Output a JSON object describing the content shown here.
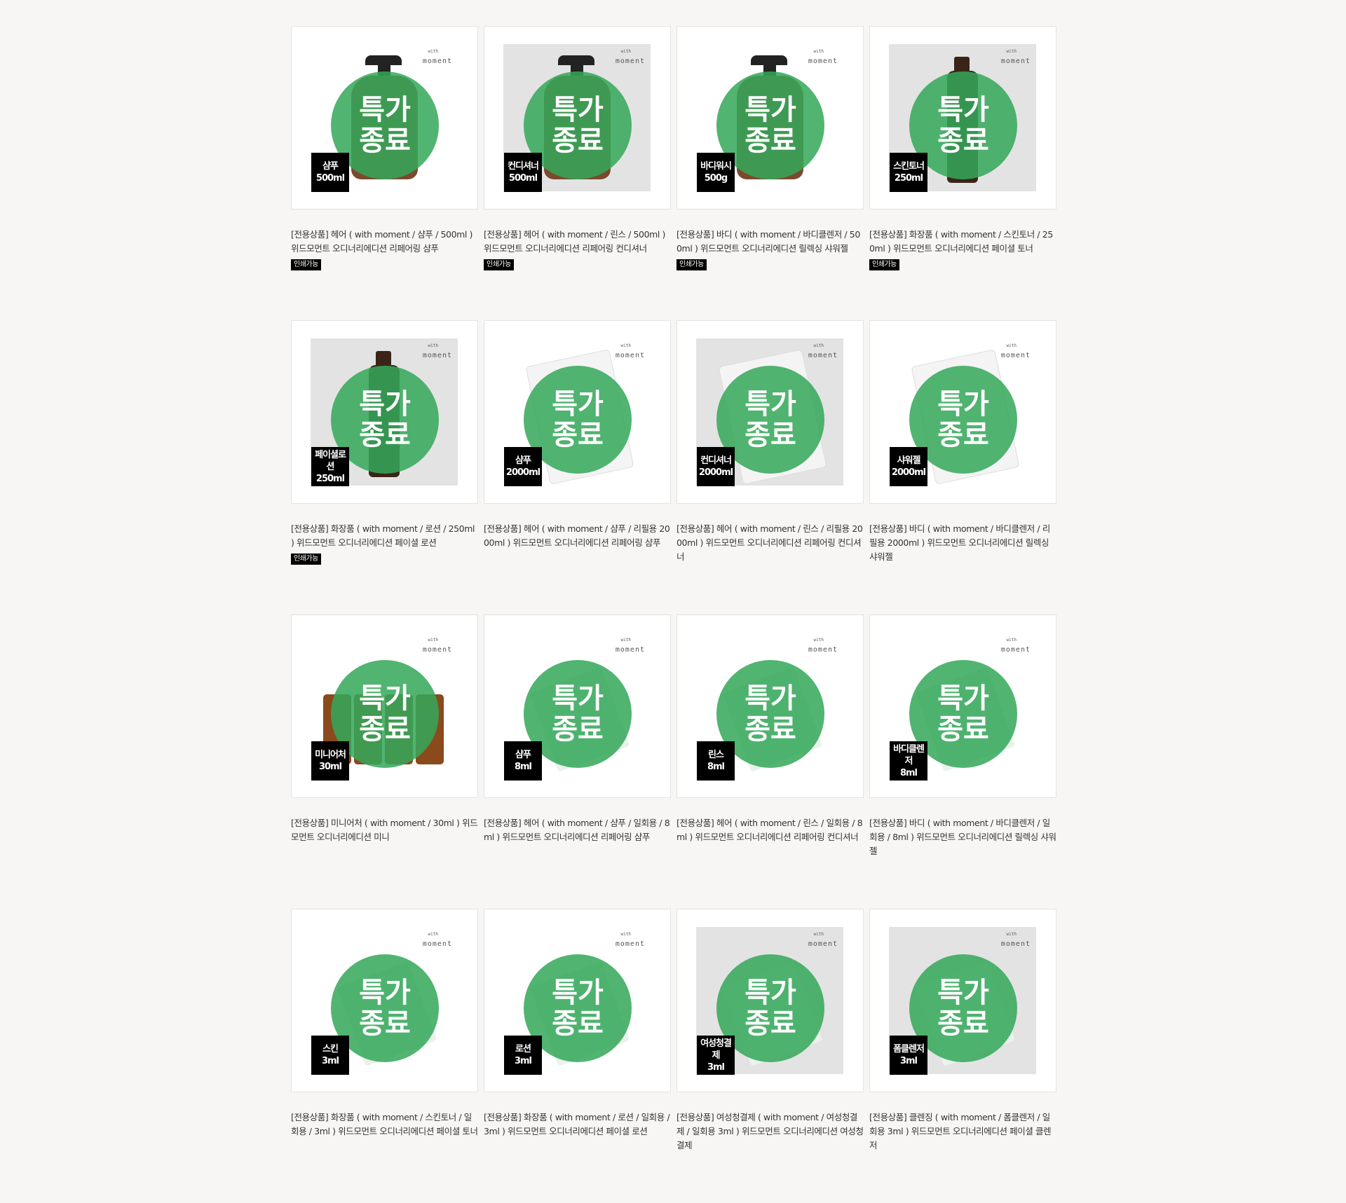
{
  "stamp_line1": "특가",
  "stamp_line2": "종료",
  "brand_small": "with",
  "brand_name": "moment",
  "colors": {
    "stamp": "#34a85a",
    "tag_bg": "#000000",
    "page_bg": "#f7f6f4"
  },
  "products": [
    {
      "tag1": "샴푸",
      "tag2": "500ml",
      "title": "[전용상품] 헤어 ( with moment / 샴푸 / 500ml ) 위드모먼트 오디너리에디션 리페어링 샴푸",
      "badge": "인쇄가능",
      "bg": "white",
      "shape": "pump-bottle"
    },
    {
      "tag1": "컨디셔너",
      "tag2": "500ml",
      "title": "[전용상품] 헤어 ( with moment / 린스 / 500ml ) 위드모먼트 오디너리에디션 리페어링 컨디셔너",
      "badge": "인쇄가능",
      "bg": "grey",
      "shape": "pump-bottle"
    },
    {
      "tag1": "바디워시",
      "tag2": "500g",
      "title": "[전용상품] 바디 ( with moment / 바디클렌저 / 500ml ) 위드모먼트 오디너리에디션 릴렉싱 샤워젤",
      "badge": "인쇄가능",
      "bg": "white",
      "shape": "pump-bottle"
    },
    {
      "tag1": "스킨토너",
      "tag2": "250ml",
      "title": "[전용상품] 화장품 ( with moment / 스킨토너 / 250ml ) 위드모먼트 오디너리에디션 페이셜 토너",
      "badge": "인쇄가능",
      "bg": "grey",
      "shape": "tall-bottle"
    },
    {
      "tag1": "페이셜로션",
      "tag2": "250ml",
      "title": "[전용상품] 화장품 ( with moment / 로션 / 250ml ) 위드모먼트 오디너리에디션 페이셜 로션",
      "badge": "인쇄가능",
      "bg": "grey",
      "shape": "tall-bottle"
    },
    {
      "tag1": "샴푸",
      "tag2": "2000ml",
      "title": "[전용상품] 헤어 ( with moment / 샴푸 / 리필용 2000ml ) 위드모먼트 오디너리에디션 리페어링 샴푸",
      "badge": "",
      "bg": "white",
      "shape": "pouch"
    },
    {
      "tag1": "컨디셔너",
      "tag2": "2000ml",
      "title": "[전용상품] 헤어 ( with moment / 린스 / 리필용 2000ml ) 위드모먼트 오디너리에디션 리페어링 컨디셔너",
      "badge": "",
      "bg": "grey",
      "shape": "pouch"
    },
    {
      "tag1": "샤워젤",
      "tag2": "2000ml",
      "title": "[전용상품] 바디 ( with moment / 바디클렌저 / 리필용 2000ml ) 위드모먼트 오디너리에디션 릴렉싱 샤워젤",
      "badge": "",
      "bg": "white",
      "shape": "pouch"
    },
    {
      "tag1": "미니어처",
      "tag2": "30ml",
      "title": "[전용상품] 미니어처 ( with moment / 30ml ) 위드모먼트 오디너리에디션 미니",
      "badge": "",
      "bg": "white",
      "shape": "minis"
    },
    {
      "tag1": "샴푸",
      "tag2": "8ml",
      "title": "[전용상품] 헤어 ( with moment / 샴푸 / 일회용 / 8ml ) 위드모먼트 오디너리에디션 리페어링 샴푸",
      "badge": "",
      "bg": "white",
      "shape": "sachet"
    },
    {
      "tag1": "린스",
      "tag2": "8ml",
      "title": "[전용상품] 헤어 ( with moment / 린스 / 일회용 / 8ml ) 위드모먼트 오디너리에디션 리페어링 컨디셔너",
      "badge": "",
      "bg": "white",
      "shape": "sachet"
    },
    {
      "tag1": "바디클렌저",
      "tag2": "8ml",
      "title": "[전용상품] 바디 ( with moment / 바디클렌저 / 일회용 / 8ml ) 위드모먼트 오디너리에디션 릴렉싱 샤워젤",
      "badge": "",
      "bg": "white",
      "shape": "sachet"
    },
    {
      "tag1": "스킨",
      "tag2": "3ml",
      "title": "[전용상품] 화장품 ( with moment / 스킨토너 / 일회용 / 3ml ) 위드모먼트 오디너리에디션 페이셜 토너",
      "badge": "",
      "bg": "white",
      "shape": "sachet"
    },
    {
      "tag1": "로션",
      "tag2": "3ml",
      "title": "[전용상품] 화장품 ( with moment / 로션 / 일회용 / 3ml ) 위드모먼트 오디너리에디션 페이셜 로션",
      "badge": "",
      "bg": "white",
      "shape": "sachet"
    },
    {
      "tag1": "여성청결제",
      "tag2": "3ml",
      "title": "[전용상품] 여성청결제 ( with moment / 여성청결제 / 일회용 3ml ) 위드모먼트 오디너리에디션 여성청결제",
      "badge": "",
      "bg": "grey",
      "shape": "sachet"
    },
    {
      "tag1": "폼클렌저",
      "tag2": "3ml",
      "title": "[전용상품] 클렌징 ( with moment / 폼클렌저 / 일회용 3ml ) 위드모먼트 오디너리에디션 페이셜 클렌저",
      "badge": "",
      "bg": "grey",
      "shape": "sachet"
    }
  ]
}
